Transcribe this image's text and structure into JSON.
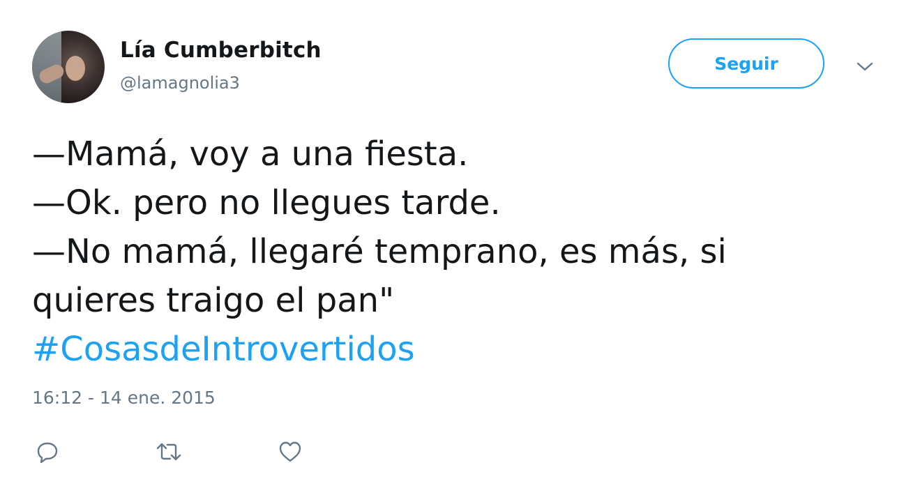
{
  "user": {
    "display_name": "Lía Cumberbitch",
    "handle": "@lamagnolia3",
    "avatar": "profile-photo"
  },
  "follow_button": {
    "label": "Seguir"
  },
  "menu": {
    "icon": "chevron-down-icon"
  },
  "tweet": {
    "lines": [
      "—Mamá, voy a una fiesta.",
      "—Ok. pero no llegues tarde.",
      "—No mamá, llegaré temprano, es más, si",
      "quieres traigo el pan\""
    ],
    "hashtag": "#CosasdeIntrovertidos",
    "timestamp": "16:12 - 14 ene. 2015"
  },
  "actions": [
    {
      "icon": "reply-icon"
    },
    {
      "icon": "retweet-icon"
    },
    {
      "icon": "like-icon"
    }
  ],
  "colors": {
    "accent": "#1da1f2",
    "text": "#14171a",
    "muted": "#657786"
  }
}
